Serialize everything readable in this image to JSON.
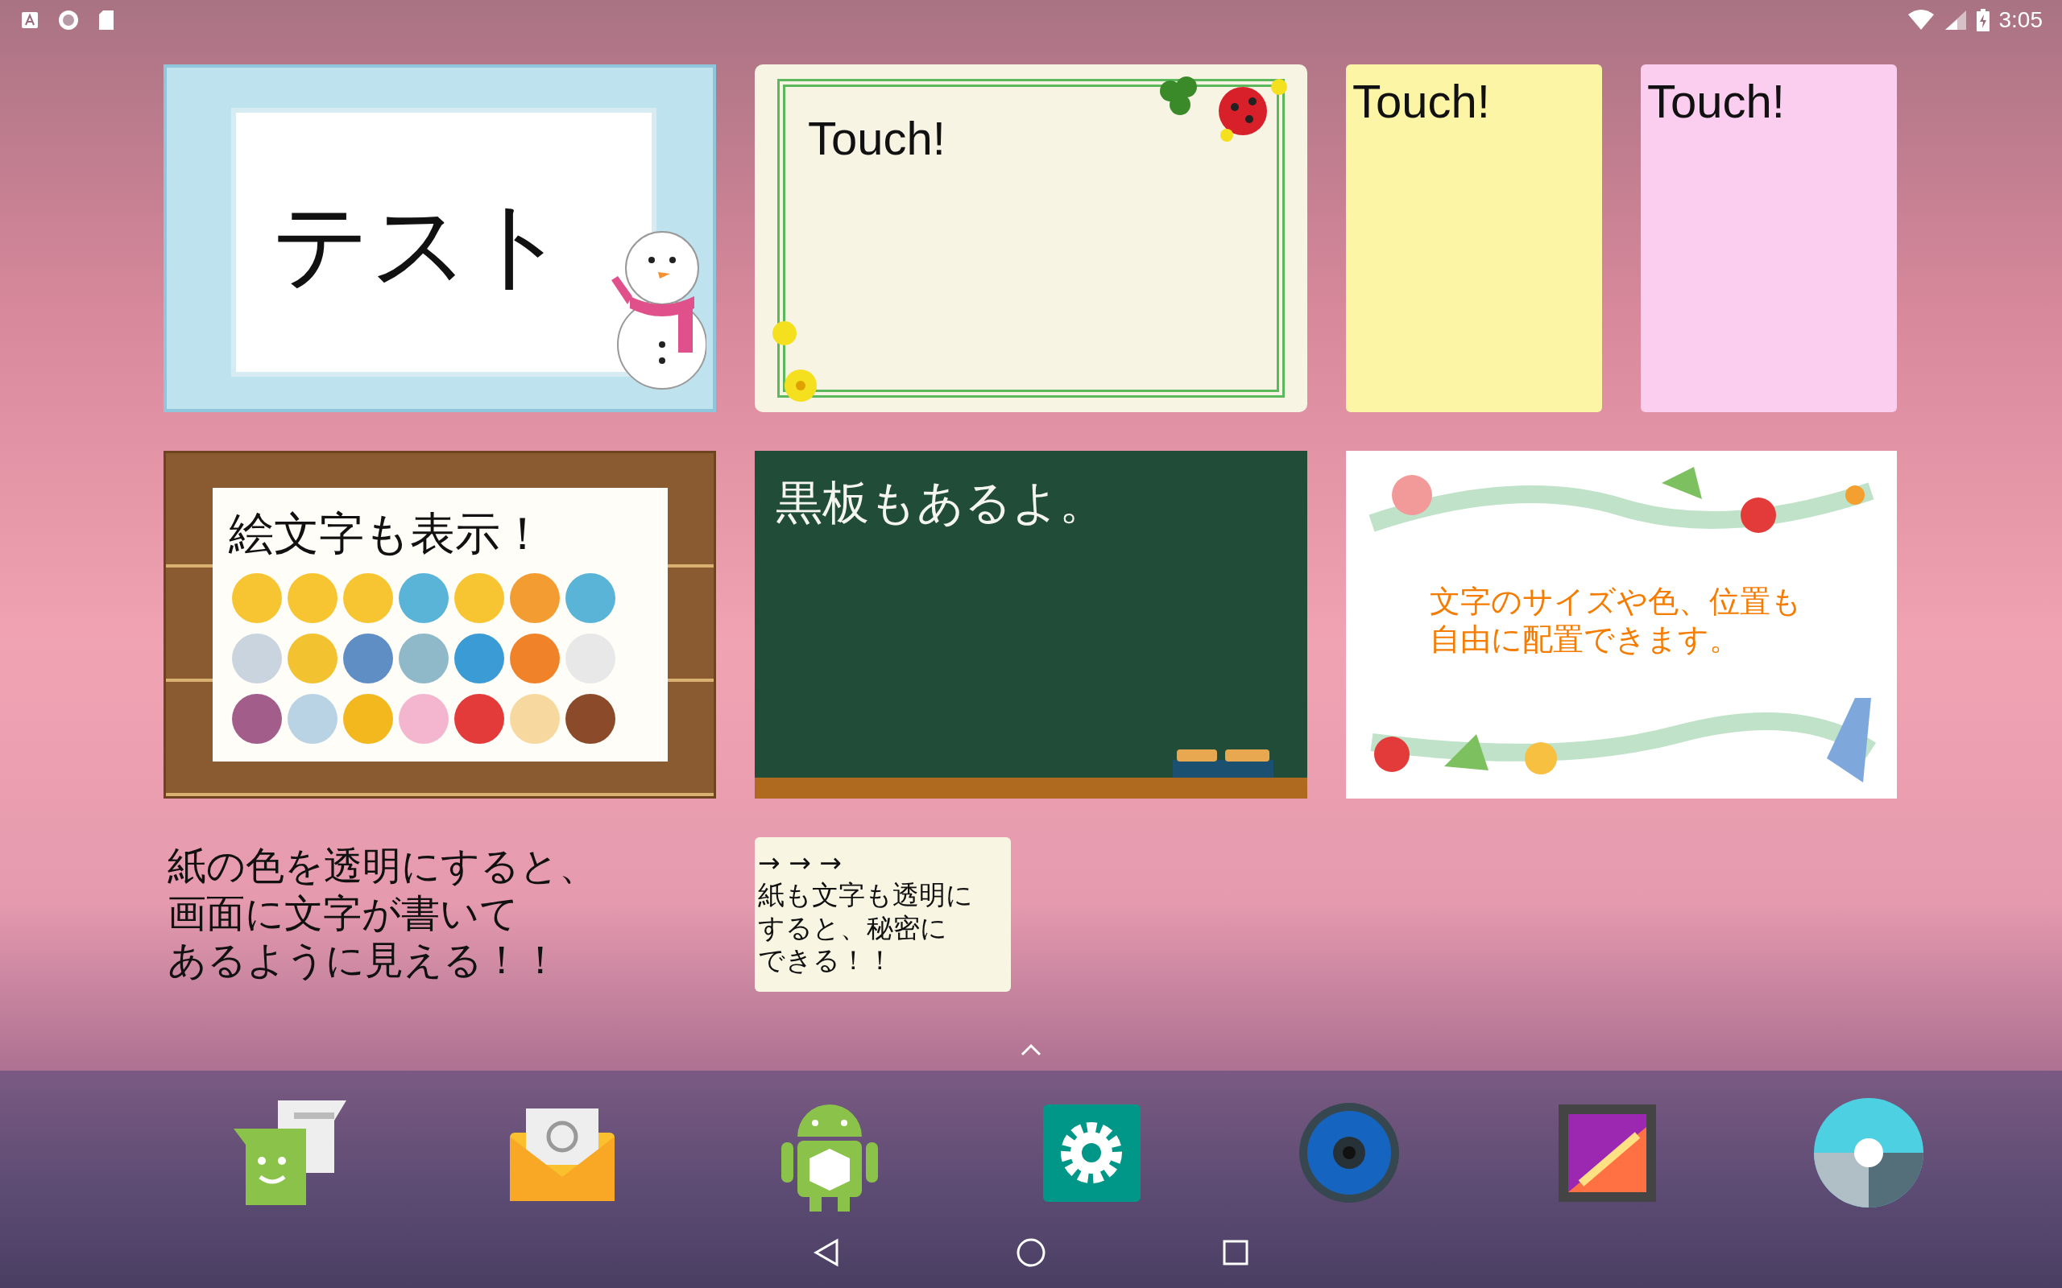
{
  "status_bar": {
    "time": "3:05"
  },
  "widgets": [
    {
      "kind": "snow",
      "text": "テスト"
    },
    {
      "kind": "clover",
      "text": "Touch!"
    },
    {
      "kind": "note",
      "color": "#fdf5a6",
      "text": "Touch!"
    },
    {
      "kind": "note",
      "color": "#fbcdef",
      "text": "Touch!"
    },
    {
      "kind": "cork",
      "text": "絵文字も表示！"
    },
    {
      "kind": "chalk",
      "text": "黒板もあるよ。"
    },
    {
      "kind": "sea",
      "lines": [
        "文字のサイズや色、位置も",
        "自由に配置できます。"
      ]
    },
    {
      "kind": "clear",
      "lines": [
        "紙の色を透明にすると、",
        "画面に文字が書いて",
        "あるように見える！！"
      ]
    },
    {
      "kind": "memo",
      "lines": [
        "→ → →",
        "紙も文字も透明に",
        "すると、秘密に",
        "できる！！"
      ]
    }
  ]
}
